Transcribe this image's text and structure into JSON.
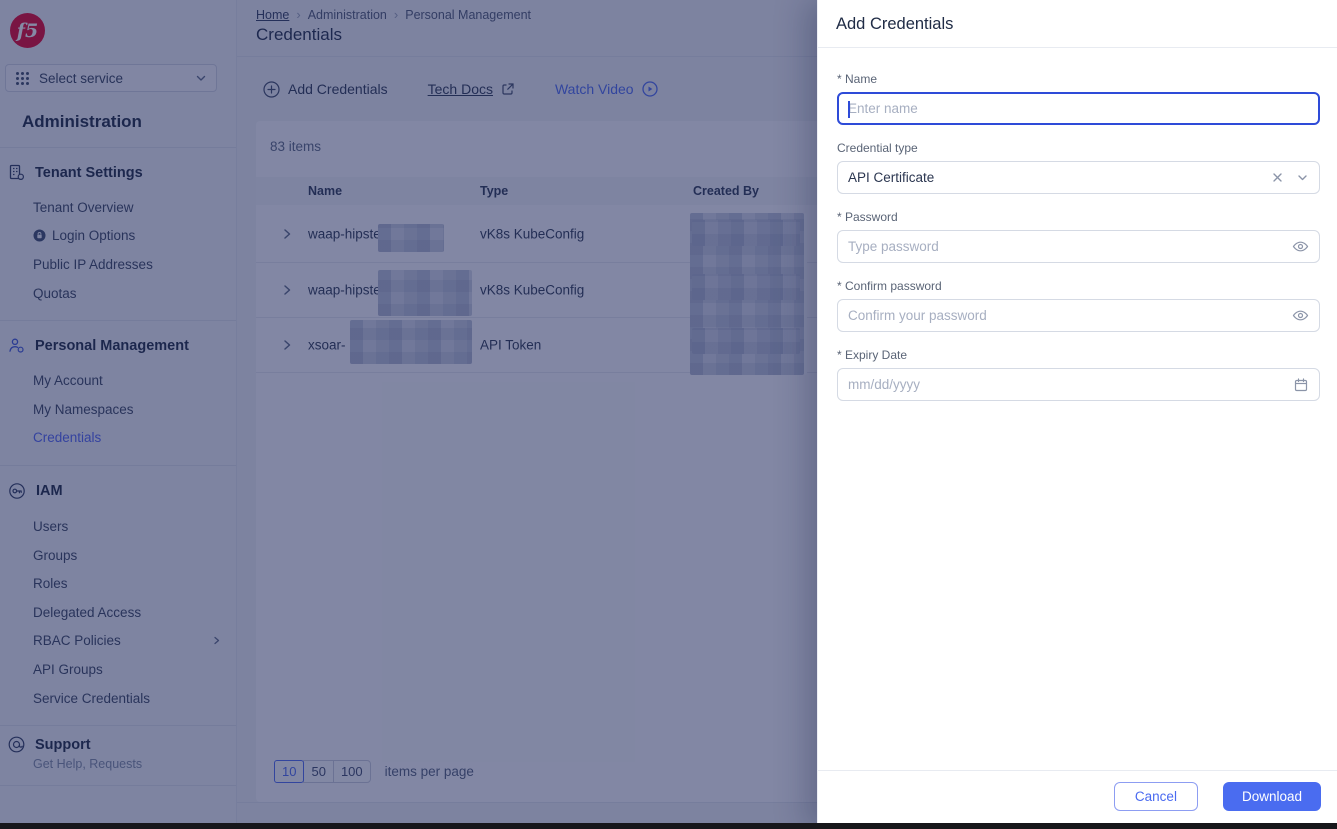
{
  "colors": {
    "accent_blue": "#4a6cf0",
    "brand_red": "#e4002b",
    "active_link": "#4f63f2"
  },
  "sidebar": {
    "logo_text": "f5",
    "service_selector_label": "Select service",
    "title": "Administration",
    "sections": [
      {
        "label": "Tenant Settings",
        "icon": "building-gear-icon",
        "items": [
          {
            "label": "Tenant Overview"
          },
          {
            "label": "Login Options"
          },
          {
            "label": "Public IP Addresses"
          },
          {
            "label": "Quotas"
          }
        ]
      },
      {
        "label": "Personal Management",
        "icon": "person-gear-icon",
        "items": [
          {
            "label": "My Account"
          },
          {
            "label": "My Namespaces"
          },
          {
            "label": "Credentials"
          }
        ]
      },
      {
        "label": "IAM",
        "icon": "key-icon",
        "items": [
          {
            "label": "Users"
          },
          {
            "label": "Groups"
          },
          {
            "label": "Roles"
          },
          {
            "label": "Delegated Access"
          },
          {
            "label": "RBAC Policies"
          },
          {
            "label": "API Groups"
          },
          {
            "label": "Service Credentials"
          }
        ]
      }
    ],
    "support": {
      "label": "Support",
      "subtitle": "Get Help, Requests"
    }
  },
  "breadcrumb": {
    "home": "Home",
    "level1": "Administration",
    "level2": "Personal Management",
    "separator": "›"
  },
  "page": {
    "title": "Credentials"
  },
  "toolbar": {
    "add_credentials": "Add Credentials",
    "tech_docs": "Tech Docs",
    "watch_video": "Watch Video"
  },
  "table": {
    "count": "83 items",
    "columns": {
      "name": "Name",
      "type": "Type",
      "created_by": "Created By"
    },
    "rows": [
      {
        "name": "waap-hipste",
        "type": "vK8s KubeConfig",
        "name_redacted": true,
        "created_by_redacted": true
      },
      {
        "name": "waap-hipste",
        "type": "vK8s KubeConfig",
        "name_redacted": true,
        "created_by_redacted": true
      },
      {
        "name": "xsoar-",
        "type": "API Token",
        "name_redacted": true,
        "created_by_redacted": true
      }
    ]
  },
  "pagination": {
    "options": [
      "10",
      "50",
      "100"
    ],
    "selected": "10",
    "label": "items per page"
  },
  "drawer": {
    "title": "Add Credentials",
    "name_field": {
      "label": "* Name",
      "placeholder": "Enter name"
    },
    "credential_type_field": {
      "label": "Credential type",
      "value": "API Certificate"
    },
    "password_field": {
      "label": "* Password",
      "placeholder": "Type password"
    },
    "confirm_password_field": {
      "label": "* Confirm password",
      "placeholder": "Confirm your password"
    },
    "expiry_date_field": {
      "label": "* Expiry Date",
      "placeholder": "mm/dd/yyyy"
    },
    "footer": {
      "cancel": "Cancel",
      "download": "Download"
    }
  }
}
